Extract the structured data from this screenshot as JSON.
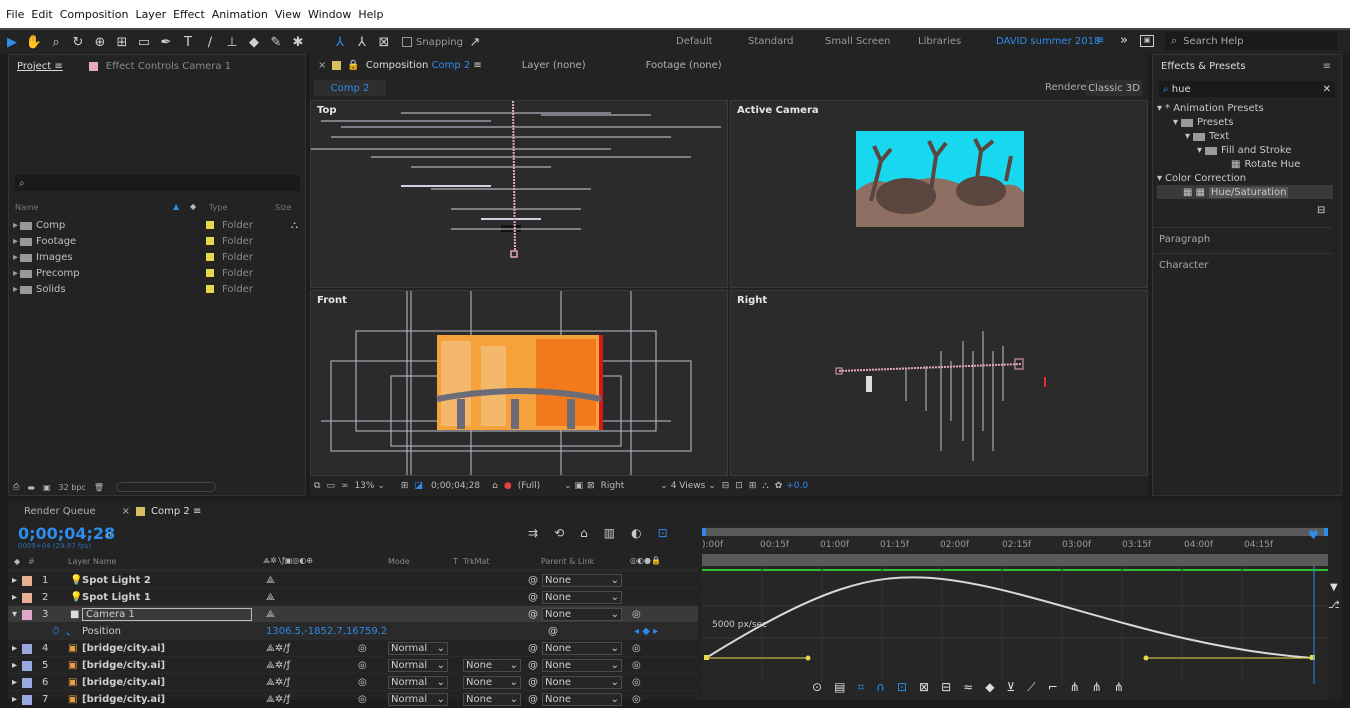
{
  "menu": [
    "File",
    "Edit",
    "Composition",
    "Layer",
    "Effect",
    "Animation",
    "View",
    "Window",
    "Help"
  ],
  "toolbar": {
    "snapping_label": "Snapping"
  },
  "workspaces": {
    "items": [
      "Default",
      "Standard",
      "Small Screen",
      "Libraries"
    ],
    "active": "DAVID summer 2018",
    "more": "»",
    "search_placeholder": "Search Help"
  },
  "project_panel": {
    "tab_project": "Project",
    "tab_effect_controls": "Effect Controls Camera 1",
    "search_placeholder": "",
    "columns": {
      "name": "Name",
      "type": "Type",
      "size": "Size"
    },
    "items": [
      {
        "name": "Comp",
        "type": "Folder"
      },
      {
        "name": "Footage",
        "type": "Folder"
      },
      {
        "name": "Images",
        "type": "Folder"
      },
      {
        "name": "Precomp",
        "type": "Folder"
      },
      {
        "name": "Solids",
        "type": "Folder"
      }
    ],
    "bpc": "32 bpc"
  },
  "composition_panel": {
    "tab_comp_prefix": "Composition",
    "tab_comp_name": "Comp 2",
    "tab_layer": "Layer (none)",
    "tab_footage": "Footage (none)",
    "comp_button": "Comp 2",
    "renderer_label": "Renderer:",
    "renderer_value": "Classic 3D",
    "views": {
      "top": "Top",
      "active": "Active Camera",
      "front": "Front",
      "right": "Right"
    },
    "footer": {
      "zoom": "13%",
      "timecode": "0;00;04;28",
      "resolution": "(Full)",
      "view": "Right",
      "layout": "4 Views",
      "exposure": "+0.0"
    }
  },
  "effects_panel": {
    "title": "Effects & Presets",
    "search_value": "hue",
    "tree": [
      {
        "label": "* Animation Presets",
        "indent": 0,
        "kind": "caret"
      },
      {
        "label": "Presets",
        "indent": 1,
        "kind": "folder"
      },
      {
        "label": "Text",
        "indent": 2,
        "kind": "folder"
      },
      {
        "label": "Fill and Stroke",
        "indent": 3,
        "kind": "folder"
      },
      {
        "label": "Rotate Hue",
        "indent": 4,
        "kind": "preset"
      },
      {
        "label": "Color Correction",
        "indent": 0,
        "kind": "caret"
      },
      {
        "label": "Hue/Saturation",
        "indent": 1,
        "kind": "effect"
      }
    ],
    "paragraph": "Paragraph",
    "character": "Character"
  },
  "timeline": {
    "tab_render_queue": "Render Queue",
    "tab_comp": "Comp 2",
    "timecode": "0;00;04;28",
    "frame_info": "0009+04 (29.97 fps)",
    "columns": {
      "num": "#",
      "layer_name": "Layer Name",
      "mode": "Mode",
      "t": "T",
      "trkmat": "TrkMat",
      "parent": "Parent & Link"
    },
    "layers": [
      {
        "num": "1",
        "name": "Spot Light 2",
        "color": "#e8b090",
        "kind": "light",
        "mode": "",
        "trkmat": "",
        "parent": "None",
        "expanded": false
      },
      {
        "num": "2",
        "name": "Spot Light 1",
        "color": "#e8b090",
        "kind": "light",
        "mode": "",
        "trkmat": "",
        "parent": "None",
        "expanded": false
      },
      {
        "num": "3",
        "name": "Camera 1",
        "color": "#e0a8c8",
        "kind": "camera",
        "mode": "",
        "trkmat": "",
        "parent": "None",
        "expanded": true,
        "selected": true
      },
      {
        "num": "4",
        "name": "[bridge/city.ai]",
        "color": "#9aa8e0",
        "kind": "ai",
        "mode": "Normal",
        "trkmat": "",
        "parent": "None",
        "expanded": false
      },
      {
        "num": "5",
        "name": "[bridge/city.ai]",
        "color": "#9aa8e0",
        "kind": "ai",
        "mode": "Normal",
        "trkmat": "None",
        "parent": "None",
        "expanded": false
      },
      {
        "num": "6",
        "name": "[bridge/city.ai]",
        "color": "#9aa8e0",
        "kind": "ai",
        "mode": "Normal",
        "trkmat": "None",
        "parent": "None",
        "expanded": false
      },
      {
        "num": "7",
        "name": "[bridge/city.ai]",
        "color": "#9aa8e0",
        "kind": "ai",
        "mode": "Normal",
        "trkmat": "None",
        "parent": "None",
        "expanded": false
      }
    ],
    "position_prop": {
      "name": "Position",
      "value": "1306.5,-1852.7,16759.2"
    },
    "ruler": [
      "):00f",
      "00:15f",
      "01:00f",
      "01:15f",
      "02:00f",
      "02:15f",
      "03:00f",
      "03:15f",
      "04:00f",
      "04:15f"
    ],
    "graph_label": "5000 px/sec"
  }
}
